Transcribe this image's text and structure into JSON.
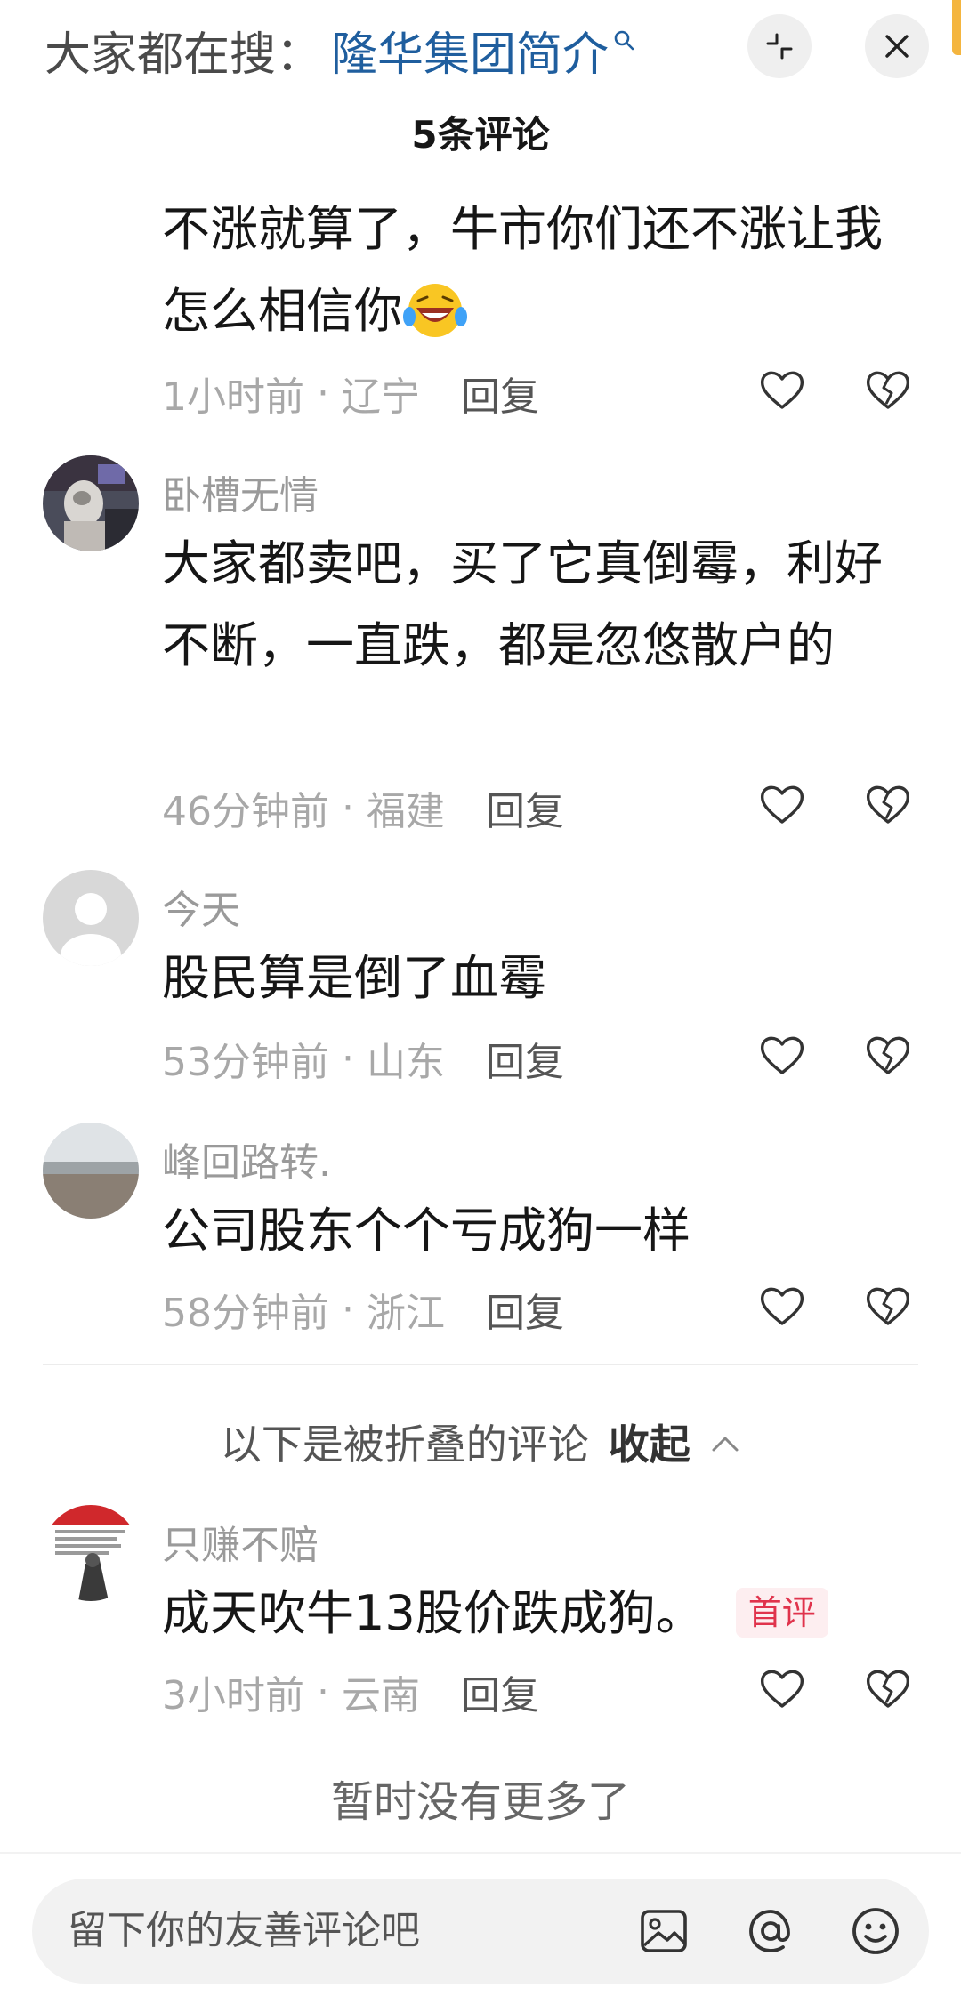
{
  "header": {
    "search_prefix": "大家都在搜：",
    "search_term": "隆华集团简介",
    "comment_count": "5条评论"
  },
  "comments": [
    {
      "username": "",
      "text": "不涨就算了，牛市你们还不涨让我怎么相信你",
      "emoji": "laughing-crying-emoji",
      "time": "1小时前",
      "location": "辽宁",
      "reply": "回复"
    },
    {
      "username": "卧槽无情",
      "text": "大家都卖吧，买了它真倒霉，利好不断，一直跌，都是忽悠散户的",
      "time": "46分钟前",
      "location": "福建",
      "reply": "回复"
    },
    {
      "username": "今天",
      "text": "股民算是倒了血霉",
      "time": "53分钟前",
      "location": "山东",
      "reply": "回复"
    },
    {
      "username": "峰回路转.",
      "text": "公司股东个个亏成狗一样",
      "time": "58分钟前",
      "location": "浙江",
      "reply": "回复"
    }
  ],
  "folded": {
    "label": "以下是被折叠的评论",
    "collapse": "收起"
  },
  "folded_comment": {
    "username": "只赚不赔",
    "text": "成天吹牛13股价跌成狗。",
    "badge": "首评",
    "time": "3小时前",
    "location": "云南",
    "reply": "回复"
  },
  "no_more": "暂时没有更多了",
  "input": {
    "placeholder": "留下你的友善评论吧"
  },
  "icons": [
    "search-icon",
    "collapse-icon",
    "close-icon",
    "heart-icon",
    "broken-heart-icon",
    "image-icon",
    "at-icon",
    "smile-icon"
  ],
  "colors": {
    "search_term": "#1f5e9e",
    "badge_text": "#e0334c",
    "badge_bg": "#fdeef0"
  }
}
